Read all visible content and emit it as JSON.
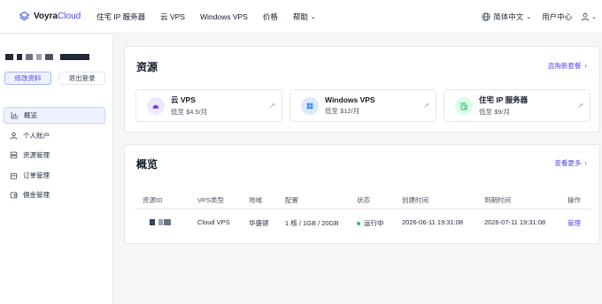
{
  "brand": {
    "name": "Voyra",
    "name_accent": "Cloud",
    "accent_color": "#4f46e5"
  },
  "nav": {
    "items": [
      {
        "label": "住宅 IP 服务器"
      },
      {
        "label": "云 VPS"
      },
      {
        "label": "Windows VPS"
      },
      {
        "label": "价格"
      },
      {
        "label": "帮助"
      }
    ],
    "language": "简体中文",
    "user_center": "用户中心"
  },
  "sidebar": {
    "edit_profile": "修改资料",
    "logout": "退出登录",
    "menu": [
      {
        "label": "概览",
        "icon": "chart-icon",
        "active": true
      },
      {
        "label": "个人账户",
        "icon": "user-icon",
        "active": false
      },
      {
        "label": "资源管理",
        "icon": "server-icon",
        "active": false
      },
      {
        "label": "订单管理",
        "icon": "bag-icon",
        "active": false
      },
      {
        "label": "佣金管理",
        "icon": "wallet-icon",
        "active": false
      }
    ]
  },
  "resources": {
    "title": "资源",
    "link": "选购新套餐",
    "products": [
      {
        "name": "云 VPS",
        "price": "低至 $4.5/月",
        "icon": "cloud-icon",
        "color": "#7c3aed"
      },
      {
        "name": "Windows VPS",
        "price": "低至 $12/月",
        "icon": "windows-icon",
        "color": "#3b82f6"
      },
      {
        "name": "住宅 IP 服务器",
        "price": "低至 $9/月",
        "icon": "building-icon",
        "color": "#22c55e"
      }
    ]
  },
  "overview": {
    "title": "概览",
    "link": "查看更多",
    "columns": [
      "资源ID",
      "VPS类型",
      "地域",
      "配置",
      "状态",
      "创建时间",
      "到期时间",
      "操作"
    ],
    "rows": [
      {
        "type": "Cloud VPS",
        "region": "华盛顿",
        "config": "1 核 / 1GB / 20GB",
        "status": "运行中",
        "created": "2026-06-11 19:31:08",
        "expires": "2026-07-11 19:31:08",
        "action": "管理"
      }
    ]
  }
}
